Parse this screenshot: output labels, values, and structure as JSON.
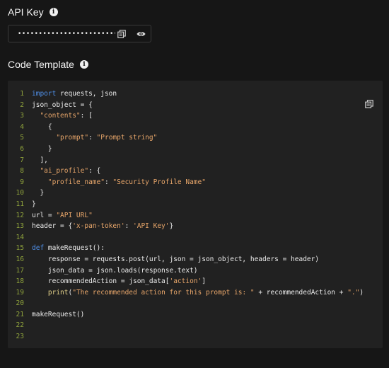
{
  "api_key": {
    "title": "API Key",
    "masked_value": "•••••••••••••••••••••••••"
  },
  "code_template": {
    "title": "Code Template",
    "lines": [
      {
        "n": "1",
        "tokens": [
          {
            "t": "import",
            "c": "kw"
          },
          {
            "t": " requests, json",
            "c": "plain"
          }
        ]
      },
      {
        "n": "2",
        "tokens": [
          {
            "t": "json_object = {",
            "c": "plain"
          }
        ]
      },
      {
        "n": "3",
        "tokens": [
          {
            "t": "  ",
            "c": "plain"
          },
          {
            "t": "\"contents\"",
            "c": "str"
          },
          {
            "t": ": [",
            "c": "plain"
          }
        ]
      },
      {
        "n": "4",
        "tokens": [
          {
            "t": "    {",
            "c": "plain"
          }
        ]
      },
      {
        "n": "5",
        "tokens": [
          {
            "t": "      ",
            "c": "plain"
          },
          {
            "t": "\"prompt\"",
            "c": "str"
          },
          {
            "t": ": ",
            "c": "plain"
          },
          {
            "t": "\"Prompt string\"",
            "c": "str"
          }
        ]
      },
      {
        "n": "6",
        "tokens": [
          {
            "t": "    }",
            "c": "plain"
          }
        ]
      },
      {
        "n": "7",
        "tokens": [
          {
            "t": "  ],",
            "c": "plain"
          }
        ]
      },
      {
        "n": "8",
        "tokens": [
          {
            "t": "  ",
            "c": "plain"
          },
          {
            "t": "\"ai_profile\"",
            "c": "str"
          },
          {
            "t": ": {",
            "c": "plain"
          }
        ]
      },
      {
        "n": "9",
        "tokens": [
          {
            "t": "    ",
            "c": "plain"
          },
          {
            "t": "\"profile_name\"",
            "c": "str"
          },
          {
            "t": ": ",
            "c": "plain"
          },
          {
            "t": "\"Security Profile Name\"",
            "c": "str"
          }
        ]
      },
      {
        "n": "10",
        "tokens": [
          {
            "t": "  }",
            "c": "plain"
          }
        ]
      },
      {
        "n": "11",
        "tokens": [
          {
            "t": "}",
            "c": "plain"
          }
        ]
      },
      {
        "n": "12",
        "tokens": [
          {
            "t": "url = ",
            "c": "plain"
          },
          {
            "t": "\"API URL\"",
            "c": "str"
          }
        ]
      },
      {
        "n": "13",
        "tokens": [
          {
            "t": "header = {",
            "c": "plain"
          },
          {
            "t": "'x-pan-token'",
            "c": "str"
          },
          {
            "t": ": ",
            "c": "plain"
          },
          {
            "t": "'API Key'",
            "c": "str"
          },
          {
            "t": "}",
            "c": "plain"
          }
        ]
      },
      {
        "n": "14",
        "tokens": []
      },
      {
        "n": "15",
        "tokens": [
          {
            "t": "def",
            "c": "kw"
          },
          {
            "t": " makeRequest():",
            "c": "plain"
          }
        ]
      },
      {
        "n": "16",
        "tokens": [
          {
            "t": "    response = requests.post(url, json = json_object, headers = header)",
            "c": "plain"
          }
        ]
      },
      {
        "n": "17",
        "tokens": [
          {
            "t": "    json_data = json.loads(response.text)",
            "c": "plain"
          }
        ]
      },
      {
        "n": "18",
        "tokens": [
          {
            "t": "    recommendedAction = json_data[",
            "c": "plain"
          },
          {
            "t": "'action'",
            "c": "str"
          },
          {
            "t": "]",
            "c": "plain"
          }
        ]
      },
      {
        "n": "19",
        "tokens": [
          {
            "t": "    ",
            "c": "plain"
          },
          {
            "t": "print",
            "c": "fn"
          },
          {
            "t": "(",
            "c": "plain"
          },
          {
            "t": "\"The recommended action for this prompt is: \"",
            "c": "str"
          },
          {
            "t": " + recommendedAction + ",
            "c": "plain"
          },
          {
            "t": "\".\"",
            "c": "str"
          },
          {
            "t": ")",
            "c": "plain"
          }
        ]
      },
      {
        "n": "20",
        "tokens": []
      },
      {
        "n": "21",
        "tokens": [
          {
            "t": "makeRequest()",
            "c": "plain"
          }
        ]
      },
      {
        "n": "22",
        "tokens": []
      },
      {
        "n": "23",
        "tokens": []
      }
    ]
  },
  "icons": {
    "info": "info-icon",
    "copy": "copy-icon",
    "visibility": "eye-icon"
  }
}
